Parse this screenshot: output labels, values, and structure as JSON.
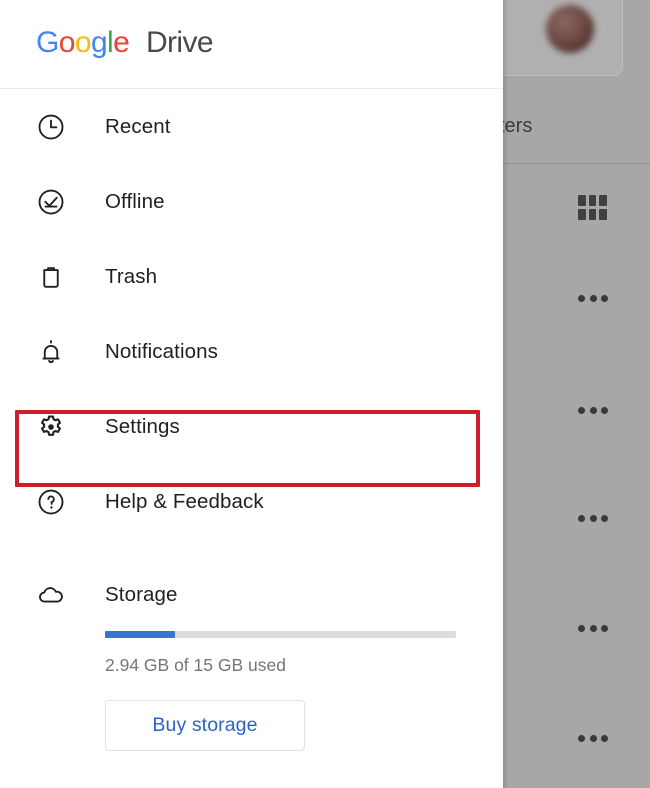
{
  "app": {
    "brand_google": "Google",
    "brand_letters": [
      "G",
      "o",
      "o",
      "g",
      "l",
      "e"
    ],
    "brand_suite": "Drive",
    "brand_colors": [
      "#4285f4",
      "#ea4335",
      "#fbbc05",
      "#4285f4",
      "#34a853",
      "#ea4335"
    ]
  },
  "drawer": {
    "items": [
      {
        "label": "Recent",
        "icon": "clock-icon"
      },
      {
        "label": "Offline",
        "icon": "check-circle-icon"
      },
      {
        "label": "Trash",
        "icon": "trash-icon"
      },
      {
        "label": "Notifications",
        "icon": "bell-icon"
      },
      {
        "label": "Settings",
        "icon": "gear-icon"
      },
      {
        "label": "Help & Feedback",
        "icon": "question-circle-icon"
      }
    ],
    "storage": {
      "label": "Storage",
      "icon": "cloud-icon",
      "usage_text": "2.94 GB of 15 GB used",
      "used_gb": 2.94,
      "total_gb": 15,
      "percent_used": 20,
      "bar_color": "#3b72cf",
      "bar_track_color": "#dcdcdc",
      "buy_button_label": "Buy storage",
      "buy_button_color": "#2a63c4"
    }
  },
  "annotation": {
    "target": "Settings",
    "color": "#cc1f2b",
    "shape": "rectangle"
  },
  "content": {
    "dimmed": true,
    "scrim_color": "#a7a7a7",
    "filters_label": "ters",
    "grid_view_icon": "grid-view-icon",
    "row_menu_icon": "more-options-icon",
    "row_menu_count": 5,
    "avatar": "account-avatar"
  }
}
